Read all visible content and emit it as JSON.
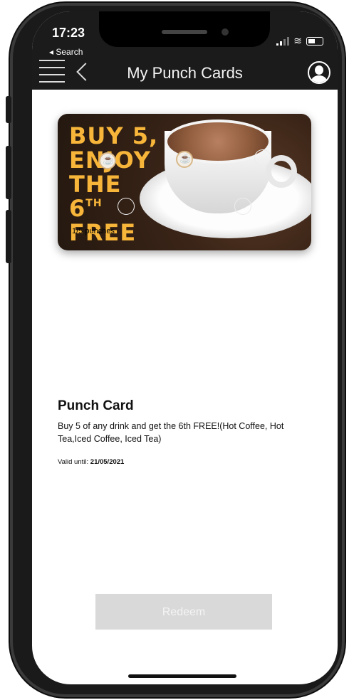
{
  "status": {
    "time": "17:23",
    "back_label": "◂ Search"
  },
  "nav": {
    "title": "My Punch Cards",
    "icons": [
      "menu-icon",
      "chevron-left-icon",
      "avatar-icon"
    ]
  },
  "promo": {
    "line1": "BUY 5,",
    "line2": "ENJOY",
    "line3": "THE",
    "line4_main": "6",
    "line4_sup": "TH",
    "line5": "FREE",
    "punch_count": "1/5 punches",
    "punched_fraction": 0.4
  },
  "card": {
    "title": "Punch Card",
    "description": "Buy 5 of any drink and get the 6th FREE!(Hot Coffee, Hot Tea,Iced Coffee, Iced Tea)",
    "valid_label": "Valid until:",
    "valid_date": "21/05/2021"
  },
  "actions": {
    "redeem_label": "Redeem"
  },
  "colors": {
    "nav_bg": "#1b1b1b",
    "promo_text": "#f7b53a",
    "redeem_disabled_bg": "#d9d9d9"
  }
}
